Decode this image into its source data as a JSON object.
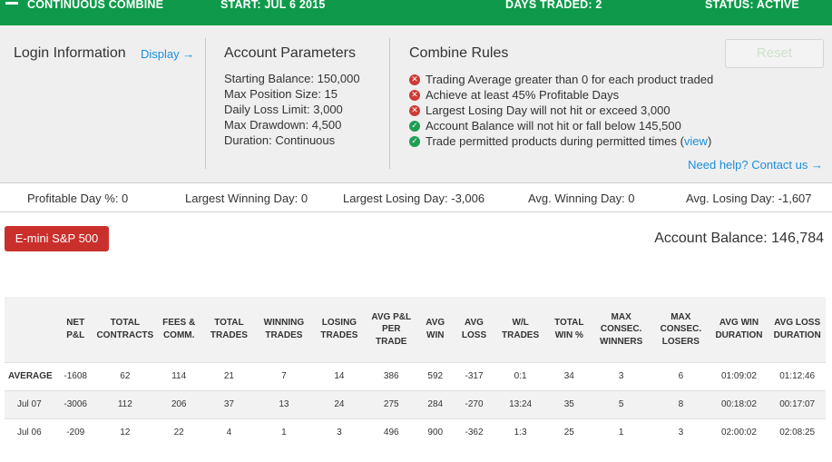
{
  "topbar": {
    "title": "CONTINUOUS COMBINE",
    "start": "START: JUL 6 2015",
    "days_traded": "DAYS TRADED: 2",
    "status": "STATUS: ACTIVE"
  },
  "login": {
    "title": "Login Information",
    "display_link": "Display →"
  },
  "account_parameters": {
    "title": "Account Parameters",
    "items": [
      "Starting Balance: 150,000",
      "Max Position Size: 15",
      "Daily Loss Limit: 3,000",
      "Max Drawdown: 4,500",
      "Duration: Continuous"
    ]
  },
  "combine_rules": {
    "title": "Combine Rules",
    "reset_label": "Reset",
    "rules": [
      {
        "text": "Trading Average greater than 0 for each product traded",
        "status": "fail"
      },
      {
        "text": "Achieve at least 45% Profitable Days",
        "status": "fail"
      },
      {
        "text": "Largest Losing Day will not hit or exceed 3,000",
        "status": "fail"
      },
      {
        "text": "Account Balance will not hit or fall below 145,500",
        "status": "pass"
      },
      {
        "text": "Trade permitted products during permitted times (",
        "status": "pass",
        "link": "view",
        "suffix": ")"
      }
    ],
    "help_link": "Need help? Contact us →"
  },
  "stats": {
    "profitable_day": "Profitable Day %: 0",
    "largest_winning_day": "Largest Winning Day: 0",
    "largest_losing_day": "Largest Losing Day: -3,006",
    "avg_winning_day": "Avg. Winning Day: 0",
    "avg_losing_day": "Avg. Losing Day: -1,607"
  },
  "product_button": "E-mini S&P 500",
  "account_balance": "Account Balance: 146,784",
  "table": {
    "headers": [
      "",
      "NET P&L",
      "TOTAL CONTRACTS",
      "FEES & COMM.",
      "TOTAL TRADES",
      "WINNING TRADES",
      "LOSING TRADES",
      "AVG P&L PER TRADE",
      "AVG WIN",
      "AVG LOSS",
      "W/L TRADES",
      "TOTAL WIN %",
      "MAX CONSEC. WINNERS",
      "MAX CONSEC. LOSERS",
      "AVG WIN DURATION",
      "AVG LOSS DURATION"
    ],
    "rows": [
      [
        "AVERAGE",
        "-1608",
        "62",
        "114",
        "21",
        "7",
        "14",
        "386",
        "592",
        "-317",
        "0:1",
        "34",
        "3",
        "6",
        "01:09:02",
        "01:12:46"
      ],
      [
        "Jul 07",
        "-3006",
        "112",
        "206",
        "37",
        "13",
        "24",
        "275",
        "284",
        "-270",
        "13:24",
        "35",
        "5",
        "8",
        "00:18:02",
        "00:17:07"
      ],
      [
        "Jul 06",
        "-209",
        "12",
        "22",
        "4",
        "1",
        "3",
        "496",
        "900",
        "-362",
        "1:3",
        "25",
        "1",
        "3",
        "02:00:02",
        "02:08:25"
      ]
    ]
  }
}
